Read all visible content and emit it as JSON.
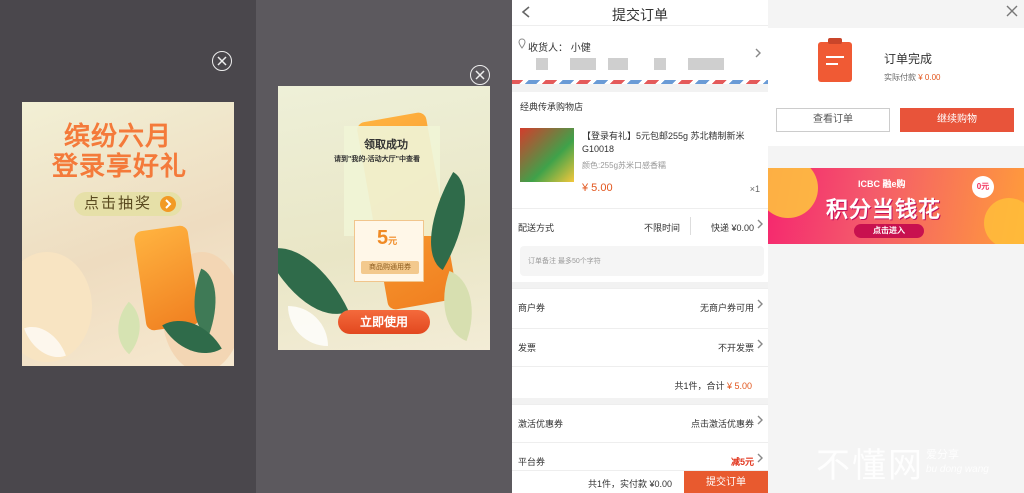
{
  "promo1": {
    "title_line1": "缤纷六月",
    "title_line2": "登录享好礼",
    "draw_button": "点击抽奖"
  },
  "promo2": {
    "success_title": "领取成功",
    "hint": "请到\"我的-活动大厅\"中查看",
    "coupon_amount": "5",
    "coupon_unit": "元",
    "coupon_tag": "商品购通用券",
    "use_button": "立即使用"
  },
  "order": {
    "title": "提交订单",
    "back_icon": "chevron-left-icon",
    "consignee_label": "收货人：",
    "consignee_name": "小健",
    "store_name": "经典传承购物店",
    "item_name": "【登录有礼】5元包邮255g 苏北精制新米 G10018",
    "item_spec": "颜色:255g苏米口感香糯",
    "item_price": "¥ 5.00",
    "item_qty": "×1",
    "shipping_label": "配送方式",
    "shipping_time": "不限时间",
    "shipping_value": "快递 ¥0.00",
    "remark_placeholder": "订单备注 最多50个字符",
    "store_coupon_label": "商户券",
    "store_coupon_value": "无商户券可用",
    "invoice_label": "发票",
    "invoice_value": "不开发票",
    "summary_prefix": "共1件，合计",
    "summary_amount": "¥ 5.00",
    "activate_coupon_label": "激活优惠券",
    "activate_coupon_value": "点击激活优惠券",
    "platform_coupon_label": "平台券",
    "platform_coupon_value": "减5元",
    "footer_sum": "共1件，实付款 ¥0.00",
    "submit_button": "提交订单"
  },
  "complete": {
    "close_icon": "close-icon",
    "title": "订单完成",
    "paid_label": "实际付款",
    "paid_amount": "¥ 0.00",
    "view_order_button": "查看订单",
    "continue_button": "继续购物",
    "banner_bank": "ICBC 融e购",
    "banner_slogan": "积分当钱花",
    "banner_badge": "0元",
    "banner_enter": "点击进入"
  },
  "watermark": {
    "main": "不懂网",
    "sub": "爱分享",
    "sub2": "bu dong wang"
  },
  "colors": {
    "accent": "#e8543a",
    "price": "#e2561e",
    "overlay1": "#4a474c",
    "overlay2": "#5c595e"
  }
}
